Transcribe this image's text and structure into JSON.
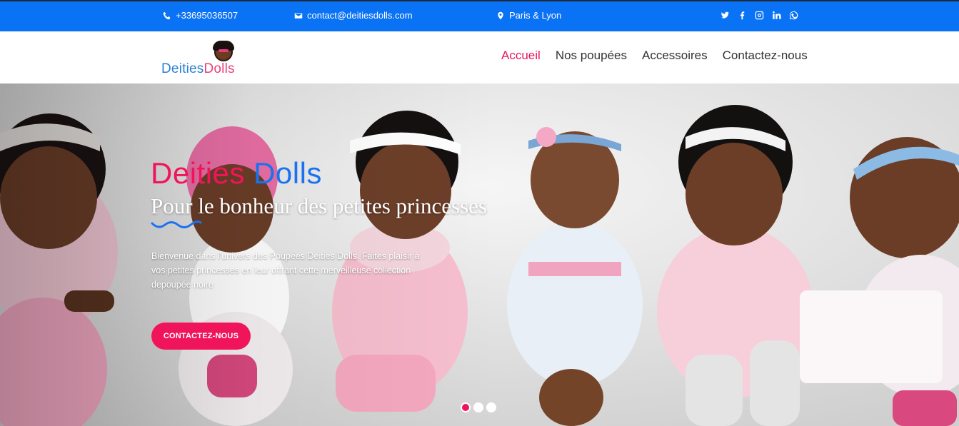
{
  "topbar": {
    "phone": "+33695036507",
    "email": "contact@deitiesdolls.com",
    "location": "Paris & Lyon",
    "icons": [
      "phone-icon",
      "mail-icon",
      "map-marker-icon"
    ],
    "social": [
      "twitter-icon",
      "facebook-icon",
      "instagram-icon",
      "linkedin-icon",
      "whatsapp-icon"
    ],
    "bg_color": "#0a72f5"
  },
  "logo": {
    "part1": "Deities",
    "part2": "Dolls"
  },
  "nav": {
    "items": [
      {
        "label": "Accueil",
        "active": true
      },
      {
        "label": "Nos poupées"
      },
      {
        "label": "Accessoires"
      },
      {
        "label": "Contactez-nous"
      }
    ],
    "active_color": "#e8175d"
  },
  "hero": {
    "title_part1": "Deities",
    "title_part2": "Dolls",
    "subtitle": "Pour le bonheur des petites princesses",
    "text": "Bienvenue dans l'univers des Poupées Deities Dolls. Faites plaisir à vos petites princesses en leur offrant cette merveilleuse collection depoupée noire",
    "cta_label": "CONTACTEZ-NOUS",
    "slides": 3,
    "active_slide": 0,
    "accent": "#f0155a"
  }
}
